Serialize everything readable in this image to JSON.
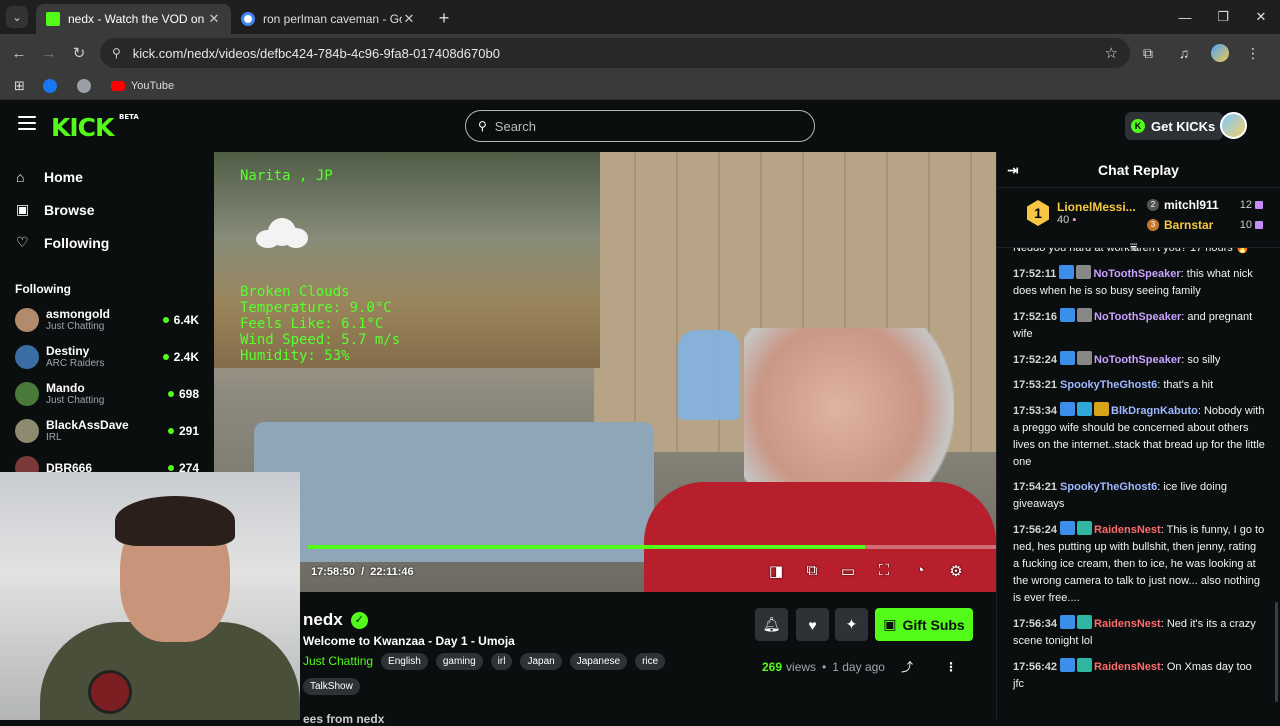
{
  "browser": {
    "tabs": [
      {
        "title": "nedx - Watch the VOD on Kick",
        "active": true,
        "favicon_color": "#53fc18"
      },
      {
        "title": "ron perlman caveman - Google",
        "active": false,
        "favicon_color": "#4285f4"
      }
    ],
    "new_tab_label": "+",
    "url": "kick.com/nedx/videos/defbc424-784b-4c96-9fa8-017408d670b0",
    "bookmarks": [
      {
        "label": "",
        "icon": "facebook-icon",
        "color": "#1877f2"
      },
      {
        "label": "",
        "icon": "globe-icon",
        "color": "#9aa0a6"
      },
      {
        "label": "YouTube",
        "icon": "youtube-icon",
        "color": "#ff0000"
      }
    ]
  },
  "header": {
    "logo": "KICK",
    "logo_badge": "BETA",
    "search_placeholder": "Search",
    "get_kicks_label": "Get KICKs"
  },
  "sidebar": {
    "nav": [
      {
        "label": "Home",
        "icon": "home-icon",
        "glyph": "⌂"
      },
      {
        "label": "Browse",
        "icon": "browse-icon",
        "glyph": "▣"
      },
      {
        "label": "Following",
        "icon": "heart-icon",
        "glyph": "♡"
      }
    ],
    "following_heading": "Following",
    "channels": [
      {
        "name": "asmongold",
        "category": "Just Chatting",
        "viewers": "6.4K",
        "avatar_color": "#b08b6e"
      },
      {
        "name": "Destiny",
        "category": "ARC Raiders",
        "viewers": "2.4K",
        "avatar_color": "#3a6ea5"
      },
      {
        "name": "Mando",
        "category": "Just Chatting",
        "viewers": "698",
        "avatar_color": "#4a7a3a"
      },
      {
        "name": "BlackAssDave",
        "category": "IRL",
        "viewers": "291",
        "avatar_color": "#8d8a70"
      },
      {
        "name": "DBR666",
        "category": "",
        "viewers": "274",
        "avatar_color": "#7a3a3a"
      }
    ]
  },
  "video": {
    "overlay": {
      "city": "Narita , JP",
      "lines": [
        "Broken Clouds",
        "Temperature: 9.0°C",
        "Feels Like: 6.1°C",
        "Wind Speed: 5.7 m/s",
        "Humidity: 53%"
      ]
    },
    "current_time": "17:58:50",
    "duration": "22:11:46",
    "time_separator": "/",
    "progress_fraction": 0.81,
    "controls": [
      "theater-mode-icon",
      "clip-icon",
      "picture-in-picture-icon",
      "fullscreen-icon",
      "playback-speed-icon",
      "settings-icon"
    ],
    "control_glyphs": [
      "◨",
      "⧉",
      "▭",
      "⛶",
      "◔",
      "⚙"
    ]
  },
  "stream_info": {
    "streamer": "nedx",
    "verified_glyph": "✓",
    "title": "Welcome to Kwanzaa - Day 1 - Umoja",
    "category": "Just Chatting",
    "tags": [
      "English",
      "gaming",
      "irl",
      "Japan",
      "Japanese",
      "rice",
      "TalkShow"
    ],
    "gift_label": "Gift Subs",
    "views_count": "269",
    "views_label": "views",
    "dot": "•",
    "age": "1 day ago",
    "more_from": "ees from nedx"
  },
  "chat": {
    "title": "Chat Replay",
    "leaderboard": {
      "first": {
        "rank": "1",
        "name": "LionelMessi...",
        "count": "40"
      },
      "others": [
        {
          "rank": "2",
          "name": "mitchl911",
          "count": "12",
          "color": "#ffffff"
        },
        {
          "rank": "3",
          "name": "Barnstar",
          "count": "10",
          "color": "#f6c744"
        }
      ]
    },
    "messages": [
      {
        "time": "",
        "user": "",
        "user_color": "#ffffff",
        "badges": [],
        "text": "Neddo you hard at work aren't you? 17 hours 🔥"
      },
      {
        "time": "17:52:11",
        "user": "NoToothSpeaker",
        "user_color": "#c9a2ff",
        "badges": [
          "#3b8eea",
          "#888888"
        ],
        "text": "this what nick does when he is so busy seeing family"
      },
      {
        "time": "17:52:16",
        "user": "NoToothSpeaker",
        "user_color": "#c9a2ff",
        "badges": [
          "#3b8eea",
          "#888888"
        ],
        "text": "and pregnant wife"
      },
      {
        "time": "17:52:24",
        "user": "NoToothSpeaker",
        "user_color": "#c9a2ff",
        "badges": [
          "#3b8eea",
          "#888888"
        ],
        "text": "so silly"
      },
      {
        "time": "17:53:21",
        "user": "SpookyTheGhost6",
        "user_color": "#9fb8ff",
        "badges": [],
        "text": "that's a hit"
      },
      {
        "time": "17:53:34",
        "user": "BlkDragnKabuto",
        "user_color": "#9fb8ff",
        "badges": [
          "#3b8eea",
          "#2fa8d8",
          "#d9a21b"
        ],
        "text": "Nobody with a preggo wife should be concerned about others lives on the internet..stack that bread up for the little one"
      },
      {
        "time": "17:54:21",
        "user": "SpookyTheGhost6",
        "user_color": "#9fb8ff",
        "badges": [],
        "text": "ice live doing giveaways"
      },
      {
        "time": "17:56:24",
        "user": "RaidensNest",
        "user_color": "#ff6b6b",
        "badges": [
          "#3b8eea",
          "#2fb5a0"
        ],
        "text": "This is funny, I go to ned, hes putting up with bullshit, then jenny, rating a fucking ice cream, then to ice, he was looking at the wrong camera to talk to just now... also nothing is ever free...."
      },
      {
        "time": "17:56:34",
        "user": "RaidensNest",
        "user_color": "#ff6b6b",
        "badges": [
          "#3b8eea",
          "#2fb5a0"
        ],
        "text": "Ned it's its a crazy scene tonight lol"
      },
      {
        "time": "17:56:42",
        "user": "RaidensNest",
        "user_color": "#ff6b6b",
        "badges": [
          "#3b8eea",
          "#2fb5a0"
        ],
        "text": "On Xmas day too jfc"
      }
    ]
  }
}
